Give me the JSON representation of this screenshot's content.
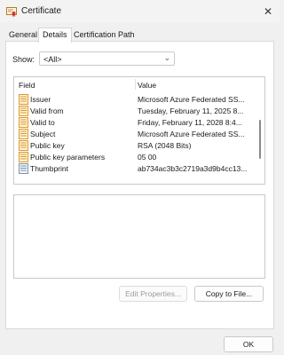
{
  "window": {
    "title": "Certificate",
    "close_glyph": "✕",
    "icon": "certificate-icon"
  },
  "tabs": [
    {
      "label": "General",
      "active": false
    },
    {
      "label": "Details",
      "active": true
    },
    {
      "label": "Certification Path",
      "active": false
    }
  ],
  "show": {
    "label": "Show:",
    "selected": "<All>",
    "chevron": "⌄"
  },
  "fields_list": {
    "header": {
      "field": "Field",
      "value": "Value"
    },
    "rows": [
      {
        "name": "Issuer",
        "value": "Microsoft Azure Federated SS...",
        "icon": "property-icon"
      },
      {
        "name": "Valid from",
        "value": "Tuesday, February 11, 2025 8...",
        "icon": "property-icon"
      },
      {
        "name": "Valid to",
        "value": "Friday, February 11, 2028 8:4...",
        "icon": "property-icon"
      },
      {
        "name": "Subject",
        "value": "Microsoft Azure Federated SS...",
        "icon": "property-icon"
      },
      {
        "name": "Public key",
        "value": "RSA (2048 Bits)",
        "icon": "property-icon"
      },
      {
        "name": "Public key parameters",
        "value": "05 00",
        "icon": "property-icon"
      },
      {
        "name": "Thumbprint",
        "value": "ab734ac3b3c2719a3d9b4cc13...",
        "icon": "thumbprint-icon"
      }
    ]
  },
  "buttons": {
    "edit_properties": "Edit Properties...",
    "copy_to_file": "Copy to File...",
    "ok": "OK"
  },
  "colors": {
    "window_bg": "#f0f0f0",
    "panel_bg": "#ffffff",
    "border": "#c9c9c9",
    "disabled_text": "#9b9b9b",
    "field_icon_accent": "#e1a43c"
  }
}
